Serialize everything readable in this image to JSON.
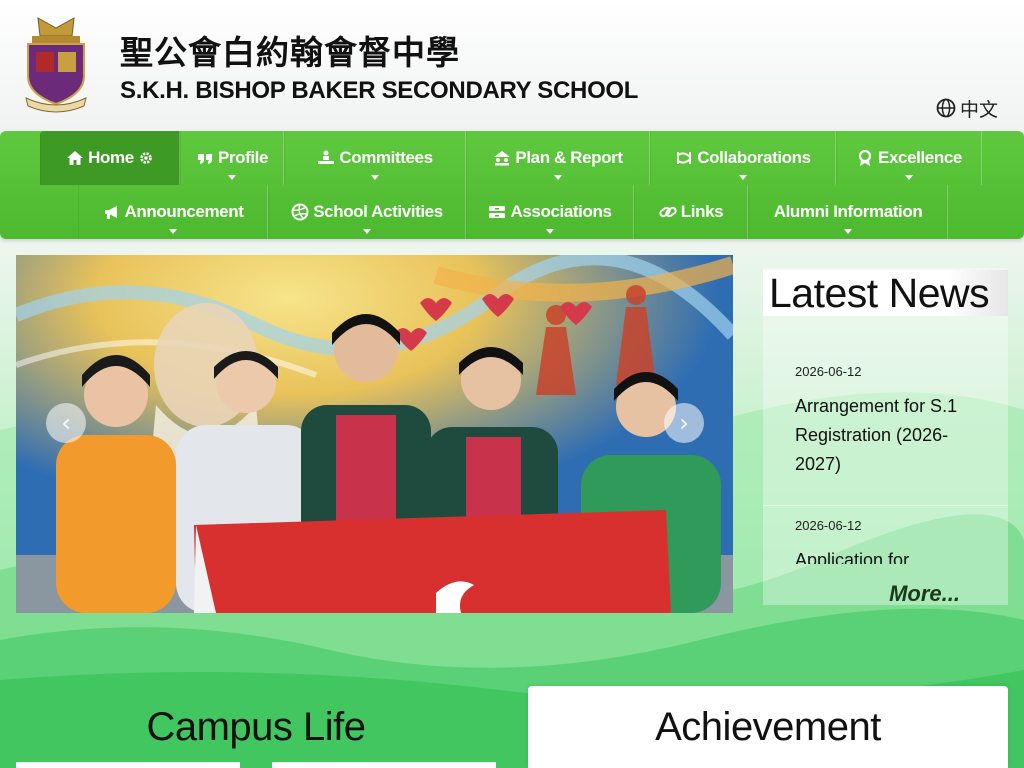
{
  "header": {
    "school_name_cn": "聖公會白約翰會督中學",
    "school_name_en": "S.K.H. BISHOP BAKER SECONDARY SCHOOL",
    "crest_icon": "school-crest-icon",
    "language_switch": "中文"
  },
  "nav": {
    "row1": [
      {
        "label": "Home",
        "icon": "home-icon",
        "active": true
      },
      {
        "label": "Profile",
        "icon": "quote-icon"
      },
      {
        "label": "Committees",
        "icon": "people-icon"
      },
      {
        "label": "Plan & Report",
        "icon": "chart-people-icon"
      },
      {
        "label": "Collaborations",
        "icon": "handshake-icon"
      },
      {
        "label": "Excellence",
        "icon": "award-icon"
      }
    ],
    "row2": [
      {
        "label": "Announcement",
        "icon": "megaphone-icon"
      },
      {
        "label": "School Activities",
        "icon": "volleyball-icon"
      },
      {
        "label": "Associations",
        "icon": "group-icon"
      },
      {
        "label": "Links",
        "icon": "link-icon"
      },
      {
        "label": "Alumni Information",
        "icon": ""
      }
    ]
  },
  "news": {
    "title": "Latest News",
    "items": [
      {
        "date": "2026-06-12",
        "headline": "Arrangement for S.1 Registration (2026-2027)"
      },
      {
        "date": "2026-06-12",
        "headline": "Application for"
      }
    ],
    "more_label": "More..."
  },
  "sections": {
    "campus_life": "Campus Life",
    "achievement": "Achievement"
  },
  "colors": {
    "nav_green": "#4db92f",
    "nav_active": "#3d9a24",
    "flag_red": "#d8302f"
  }
}
